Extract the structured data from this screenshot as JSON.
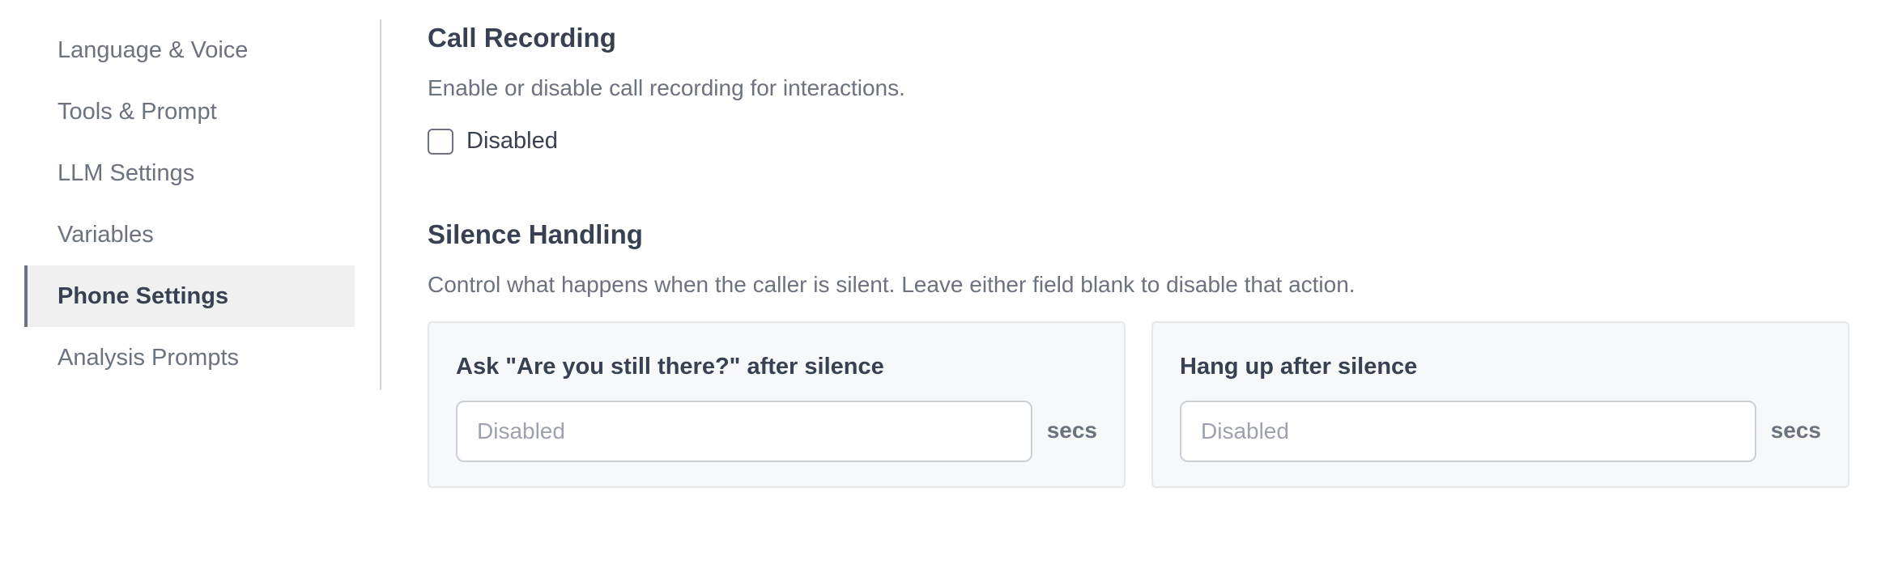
{
  "sidebar": {
    "items": [
      {
        "label": "Language & Voice",
        "active": false
      },
      {
        "label": "Tools & Prompt",
        "active": false
      },
      {
        "label": "LLM Settings",
        "active": false
      },
      {
        "label": "Variables",
        "active": false
      },
      {
        "label": "Phone Settings",
        "active": true
      },
      {
        "label": "Analysis Prompts",
        "active": false
      }
    ]
  },
  "call_recording": {
    "title": "Call Recording",
    "description": "Enable or disable call recording for interactions.",
    "checkbox_label": "Disabled",
    "checked": false
  },
  "silence_handling": {
    "title": "Silence Handling",
    "description": "Control what happens when the caller is silent. Leave either field blank to disable that action.",
    "ask_card": {
      "title": "Ask \"Are you still there?\" after silence",
      "placeholder": "Disabled",
      "value": "",
      "unit": "secs"
    },
    "hangup_card": {
      "title": "Hang up after silence",
      "placeholder": "Disabled",
      "value": "",
      "unit": "secs"
    }
  },
  "colors": {
    "text_primary": "#374151",
    "text_secondary": "#6b7280",
    "active_bg": "#f0f0f0",
    "card_bg": "#f7f8fa",
    "border": "#e5e7eb"
  }
}
